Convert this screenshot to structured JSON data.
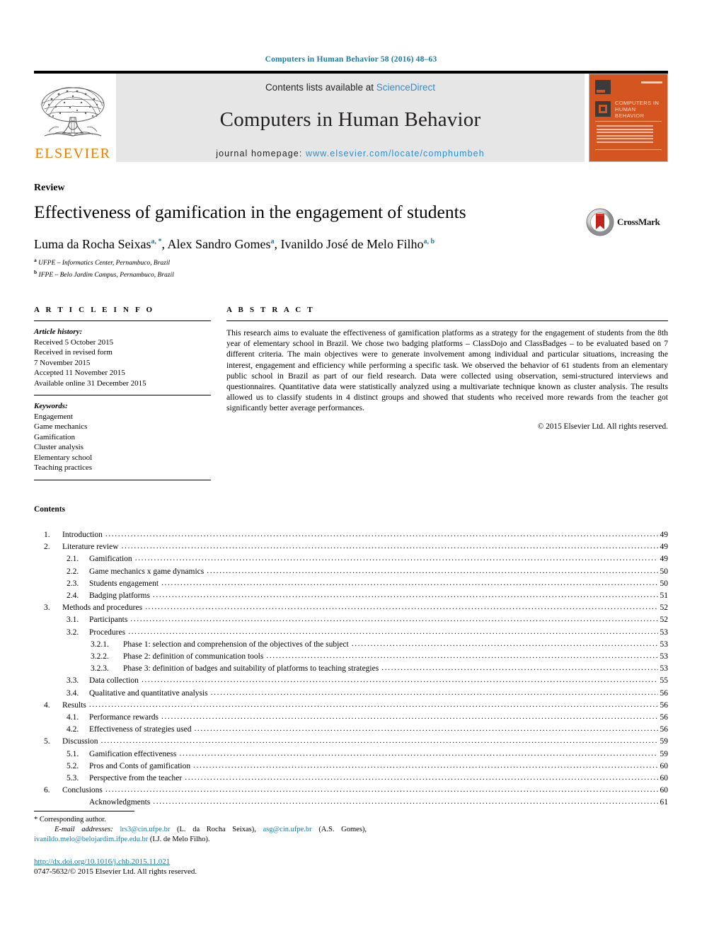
{
  "running_head": "Computers in Human Behavior 58 (2016) 48–63",
  "masthead": {
    "publisher_logo_word": "ELSEVIER",
    "contents_prefix": "Contents lists available at ",
    "contents_link": "ScienceDirect",
    "journal_name": "Computers in Human Behavior",
    "homepage_prefix": "journal homepage: ",
    "homepage_url": "www.elsevier.com/locate/comphumbeh",
    "cover_title": "COMPUTERS IN HUMAN BEHAVIOR"
  },
  "article": {
    "type_label": "Review",
    "title": "Effectiveness of gamification in the engagement of students",
    "authors": [
      {
        "name": "Luma da Rocha Seixas",
        "marks": "a, *"
      },
      {
        "name": "Alex Sandro Gomes",
        "marks": "a"
      },
      {
        "name": "Ivanildo José de Melo Filho",
        "marks": "a, b"
      }
    ],
    "affiliations": [
      {
        "mark": "a",
        "text": "UFPE – Informatics Center, Pernambuco, Brazil"
      },
      {
        "mark": "b",
        "text": "IFPE – Belo Jardim Campus, Pernambuco, Brazil"
      }
    ],
    "crossmark_label": "CrossMark"
  },
  "info": {
    "heading": "A R T I C L E   I N F O",
    "history_label": "Article history:",
    "history_lines": [
      "Received 5 October 2015",
      "Received in revised form",
      "7 November 2015",
      "Accepted 11 November 2015",
      "Available online 31 December 2015"
    ],
    "keywords_label": "Keywords:",
    "keywords": [
      "Engagement",
      "Game mechanics",
      "Gamification",
      "Cluster analysis",
      "Elementary school",
      "Teaching practices"
    ]
  },
  "abstract": {
    "heading": "A B S T R A C T",
    "text": "This research aims to evaluate the effectiveness of gamification platforms as a strategy for the engagement of students from the 8th year of elementary school in Brazil. We chose two badging platforms – ClassDojo and ClassBadges – to be evaluated based on 7 different criteria. The main objectives were to generate involvement among individual and particular situations, increasing the interest, engagement and efficiency while performing a specific task. We observed the behavior of 61 students from an elementary public school in Brazil as part of our field research. Data were collected using observation, semi-structured interviews and questionnaires. Quantitative data were statistically analyzed using a multivariate technique known as cluster analysis. The results allowed us to classify students in 4 distinct groups and showed that students who received more rewards from the teacher got significantly better average performances.",
    "copyright": "© 2015 Elsevier Ltd. All rights reserved."
  },
  "contents": {
    "heading": "Contents",
    "entries": [
      {
        "level": 1,
        "num": "1.",
        "label": "Introduction",
        "page": "49"
      },
      {
        "level": 1,
        "num": "2.",
        "label": "Literature review",
        "page": "49"
      },
      {
        "level": 2,
        "num": "2.1.",
        "label": "Gamification",
        "page": "49"
      },
      {
        "level": 2,
        "num": "2.2.",
        "label": "Game mechanics x game dynamics",
        "page": "50"
      },
      {
        "level": 2,
        "num": "2.3.",
        "label": "Students engagement",
        "page": "50"
      },
      {
        "level": 2,
        "num": "2.4.",
        "label": "Badging platforms",
        "page": "51"
      },
      {
        "level": 1,
        "num": "3.",
        "label": "Methods and procedures",
        "page": "52"
      },
      {
        "level": 2,
        "num": "3.1.",
        "label": "Participants",
        "page": "52"
      },
      {
        "level": 2,
        "num": "3.2.",
        "label": "Procedures",
        "page": "53"
      },
      {
        "level": 3,
        "num": "3.2.1.",
        "label": "Phase 1: selection and comprehension of the objectives of the subject",
        "page": "53"
      },
      {
        "level": 3,
        "num": "3.2.2.",
        "label": "Phase 2: definition of communication tools",
        "page": "53"
      },
      {
        "level": 3,
        "num": "3.2.3.",
        "label": "Phase 3: definition of badges and suitability of platforms to teaching strategies",
        "page": "53"
      },
      {
        "level": 2,
        "num": "3.3.",
        "label": "Data collection",
        "page": "55"
      },
      {
        "level": 2,
        "num": "3.4.",
        "label": "Qualitative and quantitative analysis",
        "page": "56"
      },
      {
        "level": 1,
        "num": "4.",
        "label": "Results",
        "page": "56"
      },
      {
        "level": 2,
        "num": "4.1.",
        "label": "Performance rewards",
        "page": "56"
      },
      {
        "level": 2,
        "num": "4.2.",
        "label": "Effectiveness of strategies used",
        "page": "56"
      },
      {
        "level": 1,
        "num": "5.",
        "label": "Discussion",
        "page": "59"
      },
      {
        "level": 2,
        "num": "5.1.",
        "label": "Gamification effectiveness",
        "page": "59"
      },
      {
        "level": 2,
        "num": "5.2.",
        "label": "Pros and Conts of gamification",
        "page": "60"
      },
      {
        "level": 2,
        "num": "5.3.",
        "label": "Perspective from the teacher",
        "page": "60"
      },
      {
        "level": 1,
        "num": "6.",
        "label": "Conclusions",
        "page": "60"
      },
      {
        "level": 2,
        "num": "",
        "label": "Acknowledgments",
        "page": "61"
      }
    ]
  },
  "footer": {
    "corresponding_marker": "*",
    "corresponding_text": "Corresponding author.",
    "email_label": "E-mail addresses:",
    "emails": [
      {
        "address": "lrs3@cin.ufpe.br",
        "owner": "(L. da Rocha Seixas)"
      },
      {
        "address": "asg@cin.ufpe.br",
        "owner": "(A.S. Gomes)"
      },
      {
        "address": "ivanildo.melo@belojardim.ifpe.edu.br",
        "owner": "(I.J. de Melo Filho)."
      }
    ],
    "doi": "http://dx.doi.org/10.1016/j.chb.2015.11.021",
    "issn_line": "0747-5632/© 2015 Elsevier Ltd. All rights reserved."
  },
  "colors": {
    "link_blue": "#1a7aa8",
    "sd_blue": "#2e8ccf",
    "elsevier_orange": "#f07d00",
    "cover_orange": "#d4551f"
  }
}
